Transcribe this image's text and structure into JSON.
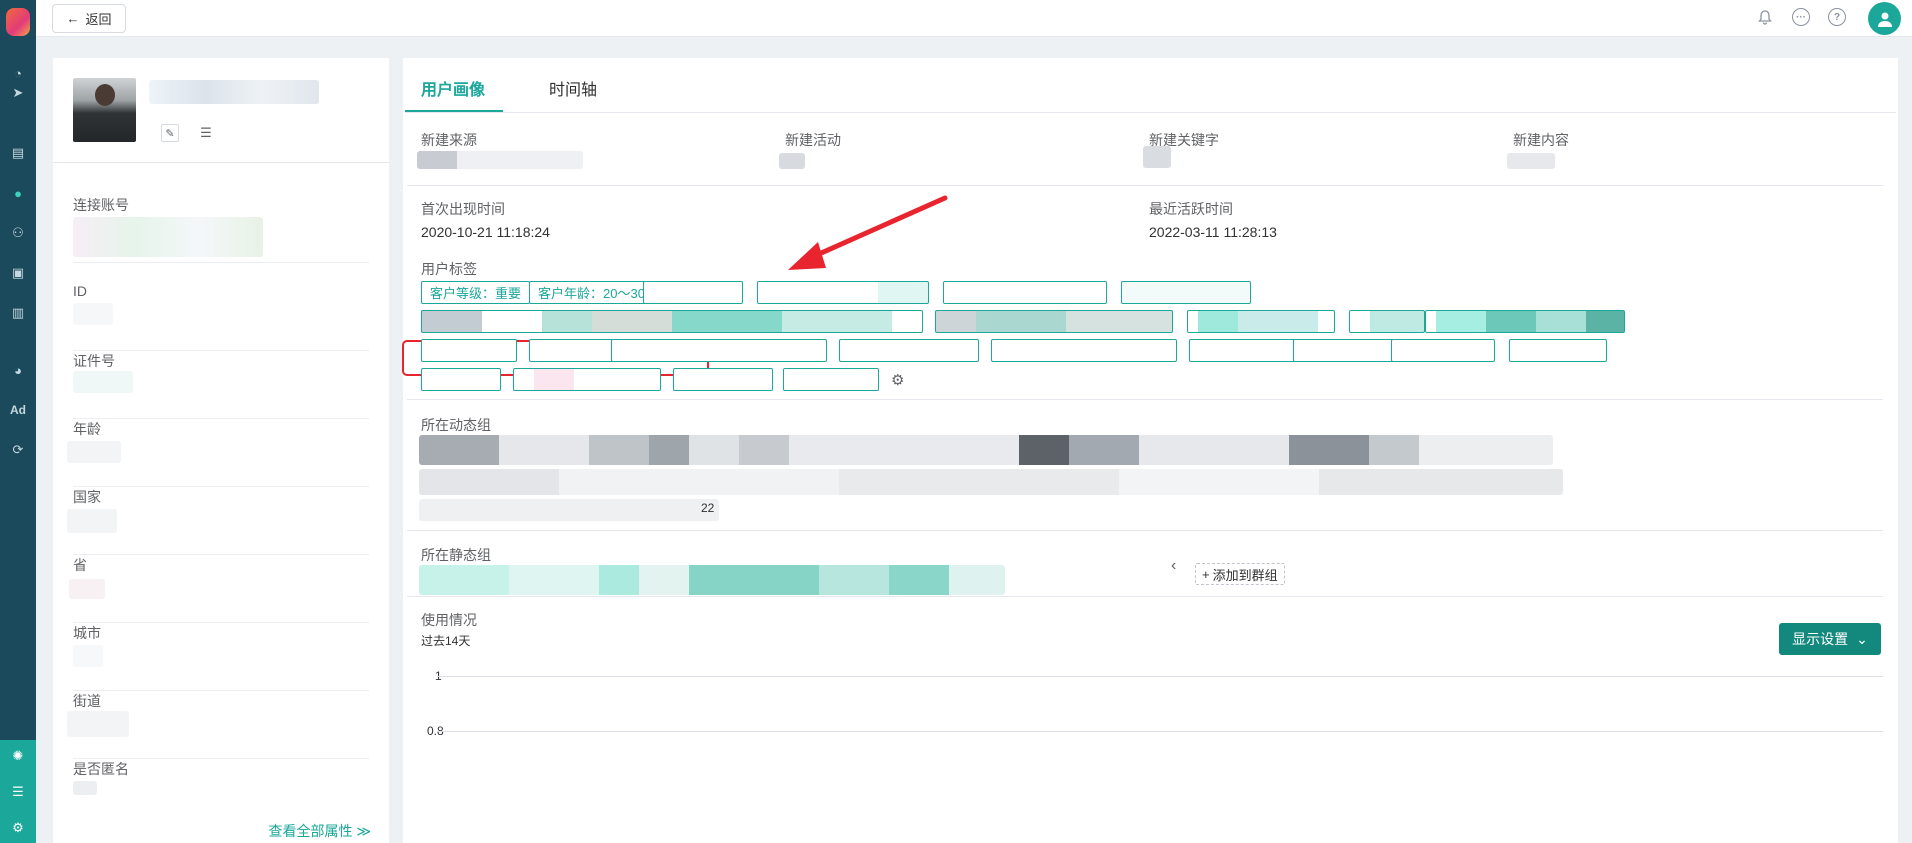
{
  "topbar": {
    "back_label": "返回",
    "icons": [
      "bell-icon",
      "chat-icon",
      "help-icon",
      "user-avatar-icon"
    ]
  },
  "nav": {
    "icons": [
      "dashboard-icon",
      "send-icon",
      "table-icon",
      "person-icon",
      "people-icon",
      "bookmark-icon",
      "bar-chart-icon",
      "wechat-icon",
      "ad-icon",
      "refresh-icon",
      "network-icon",
      "list-icon",
      "gear-icon"
    ],
    "ad_label": "Ad"
  },
  "profile": {
    "fields": [
      {
        "label": "连接账号"
      },
      {
        "label": "ID"
      },
      {
        "label": "证件号"
      },
      {
        "label": "年龄"
      },
      {
        "label": "国家"
      },
      {
        "label": "省"
      },
      {
        "label": "城市"
      },
      {
        "label": "街道"
      },
      {
        "label": "是否匿名"
      }
    ],
    "view_all": "查看全部属性 ≫"
  },
  "main": {
    "tabs": [
      {
        "label": "用户画像",
        "active": true
      },
      {
        "label": "时间轴",
        "active": false
      }
    ],
    "source_headers": [
      "新建来源",
      "新建活动",
      "新建关键字",
      "新建内容"
    ],
    "first_seen_label": "首次出现时间",
    "first_seen_value": "2020-10-21 11:18:24",
    "last_active_label": "最近活跃时间",
    "last_active_value": "2022-03-11 11:28:13",
    "tags_label": "用户标签",
    "tags_visible": [
      "客户等级：重要",
      "客户年龄：20～30"
    ],
    "dynamic_groups_label": "所在动态组",
    "dynamic_groups_fragment": "22",
    "static_groups_label": "所在静态组",
    "add_to_group": "添加到群组",
    "usage_label": "使用情况",
    "usage_range": "过去14天",
    "display_settings": "显示设置",
    "y_ticks": [
      "1",
      "0.8"
    ]
  },
  "colors": {
    "accent": "#1ba79a",
    "rail": "#1b4a5c",
    "highlight": "#e8242e"
  }
}
